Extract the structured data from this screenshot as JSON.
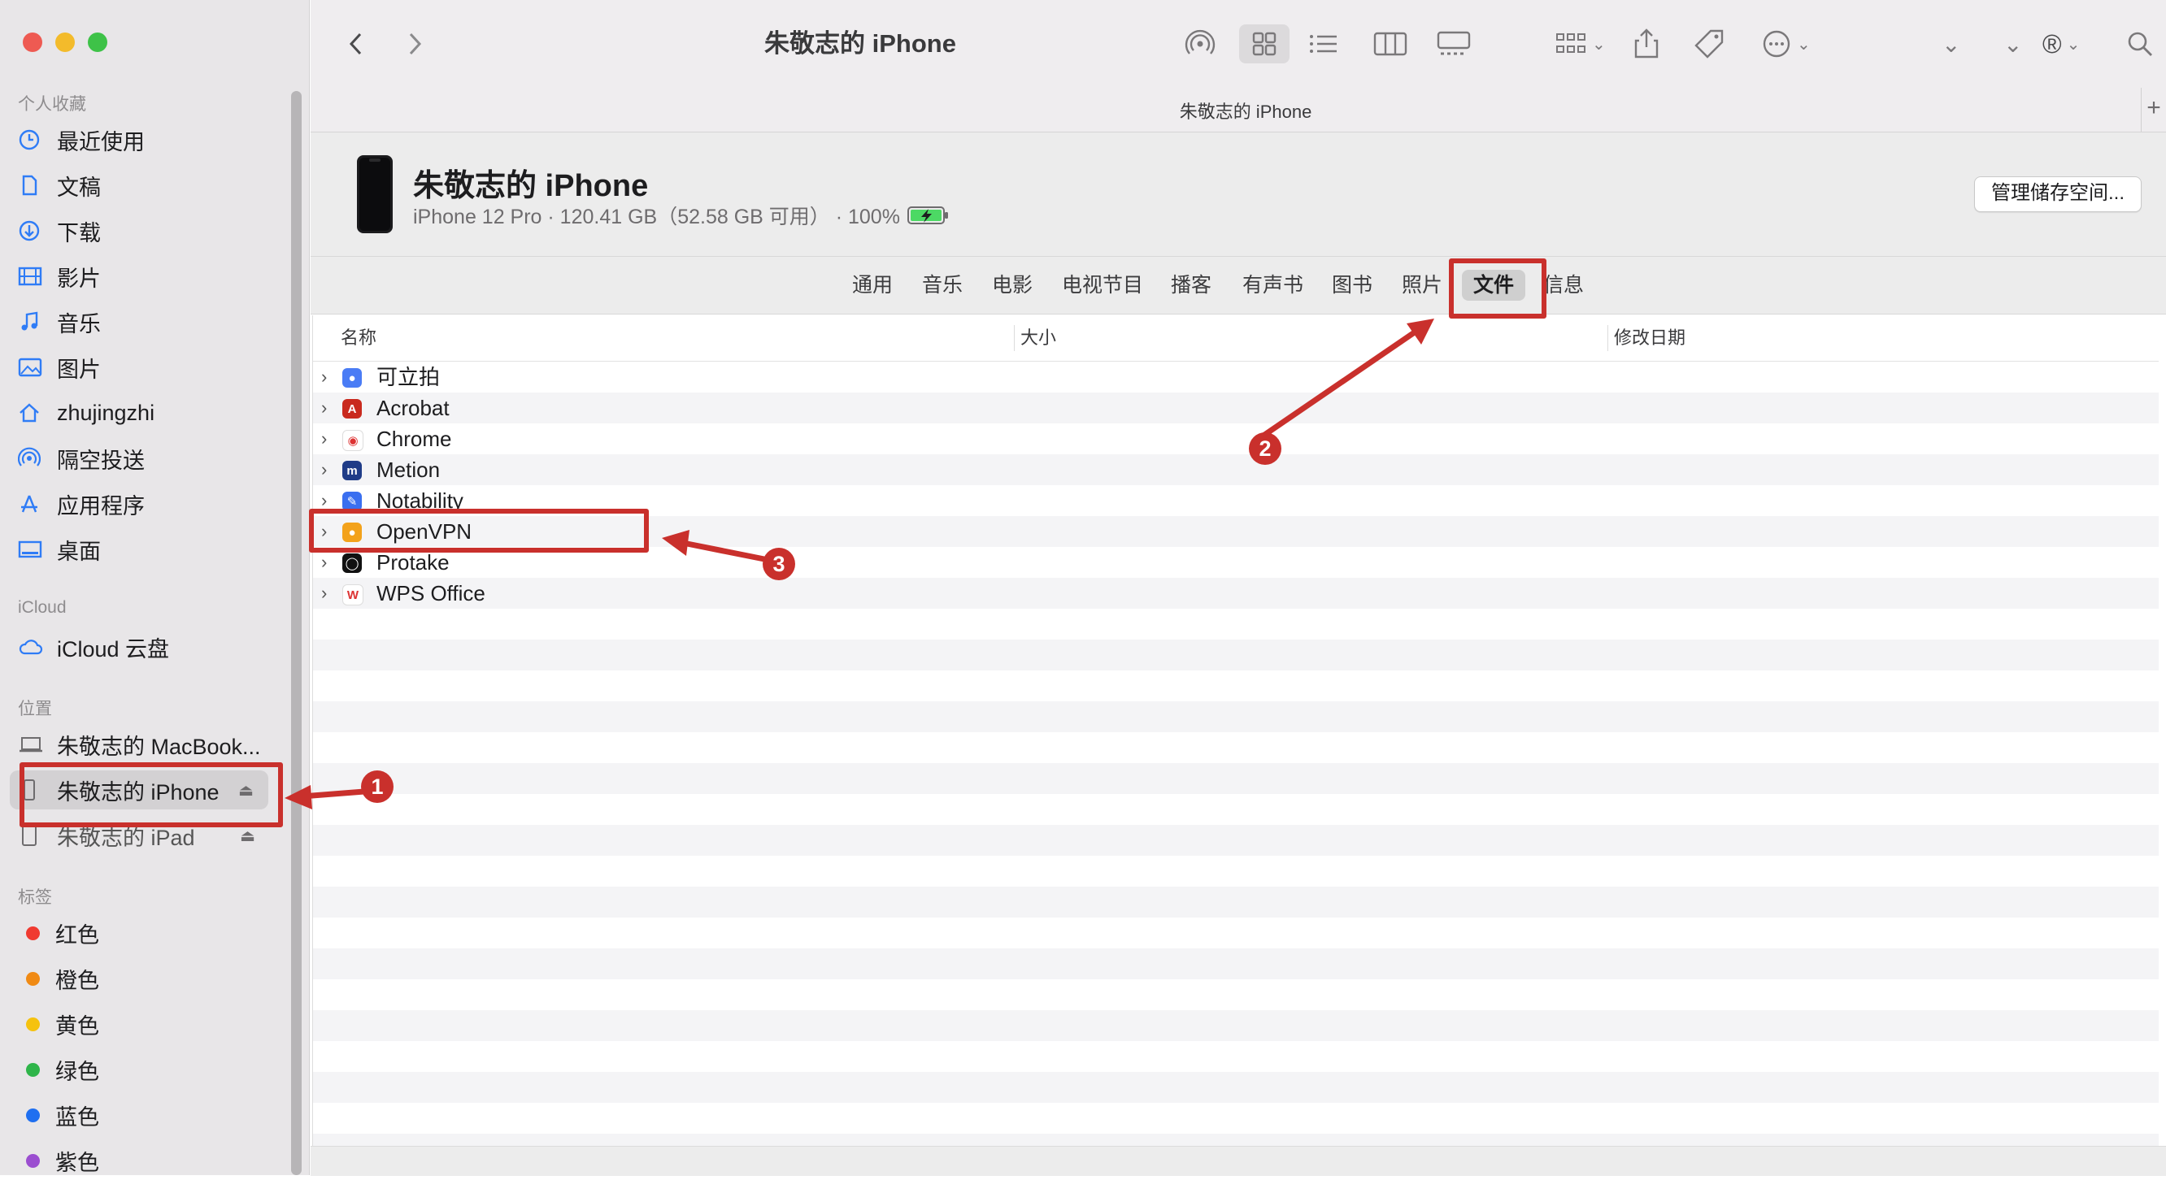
{
  "window": {
    "title": "朱敬志的 iPhone",
    "path_title": "朱敬志的 iPhone"
  },
  "sidebar": {
    "favorites_header": "个人收藏",
    "favorites": [
      {
        "label": "最近使用",
        "icon": "clock-icon"
      },
      {
        "label": "文稿",
        "icon": "document-icon"
      },
      {
        "label": "下载",
        "icon": "download-icon"
      },
      {
        "label": "影片",
        "icon": "film-icon"
      },
      {
        "label": "音乐",
        "icon": "music-note-icon"
      },
      {
        "label": "图片",
        "icon": "photo-icon"
      },
      {
        "label": "zhujingzhi",
        "icon": "home-icon"
      },
      {
        "label": "隔空投送",
        "icon": "airdrop-icon"
      },
      {
        "label": "应用程序",
        "icon": "applications-icon"
      },
      {
        "label": "桌面",
        "icon": "desktop-icon"
      }
    ],
    "icloud_header": "iCloud",
    "icloud": [
      {
        "label": "iCloud 云盘",
        "icon": "cloud-icon"
      }
    ],
    "locations_header": "位置",
    "locations": [
      {
        "label": "朱敬志的 MacBook...",
        "icon": "laptop-icon"
      },
      {
        "label": "朱敬志的 iPhone",
        "icon": "phone-icon",
        "selected": true
      },
      {
        "label": "朱敬志的 iPad",
        "icon": "tablet-icon"
      }
    ],
    "tags_header": "标签",
    "tags": [
      {
        "label": "红色",
        "color": "#f03a30"
      },
      {
        "label": "橙色",
        "color": "#f08a14"
      },
      {
        "label": "黄色",
        "color": "#f5c20e"
      },
      {
        "label": "绿色",
        "color": "#2fb54a"
      },
      {
        "label": "蓝色",
        "color": "#1f6ff0"
      },
      {
        "label": "紫色",
        "color": "#9b4ed0"
      }
    ]
  },
  "device": {
    "name": "朱敬志的 iPhone",
    "info": "iPhone 12 Pro · 120.41 GB（52.58 GB 可用） · 100%",
    "manage_button": "管理储存空间..."
  },
  "tabs": [
    {
      "label": "通用"
    },
    {
      "label": "音乐"
    },
    {
      "label": "电影"
    },
    {
      "label": "电视节目"
    },
    {
      "label": "播客"
    },
    {
      "label": "有声书"
    },
    {
      "label": "图书"
    },
    {
      "label": "照片"
    },
    {
      "label": "文件",
      "active": true
    },
    {
      "label": "信息"
    }
  ],
  "columns": {
    "name": "名称",
    "size": "大小",
    "modified": "修改日期"
  },
  "files": [
    {
      "name": "可立拍",
      "icon_color": "#4a7cf5",
      "glyph": "●"
    },
    {
      "name": "Acrobat",
      "icon_color": "#c92a1e",
      "glyph": "A"
    },
    {
      "name": "Chrome",
      "icon_color": "#ffffff",
      "glyph": "◉"
    },
    {
      "name": "Metion",
      "icon_color": "#1f3c88",
      "glyph": "m"
    },
    {
      "name": "Notability",
      "icon_color": "#3a6ff0",
      "glyph": "✎"
    },
    {
      "name": "OpenVPN",
      "icon_color": "#f3a21b",
      "glyph": "●"
    },
    {
      "name": "Protake",
      "icon_color": "#111111",
      "glyph": "◯"
    },
    {
      "name": "WPS Office",
      "icon_color": "#ffffff",
      "glyph": "W"
    }
  ],
  "annotations": {
    "badge1": "1",
    "badge2": "2",
    "badge3": "3"
  }
}
